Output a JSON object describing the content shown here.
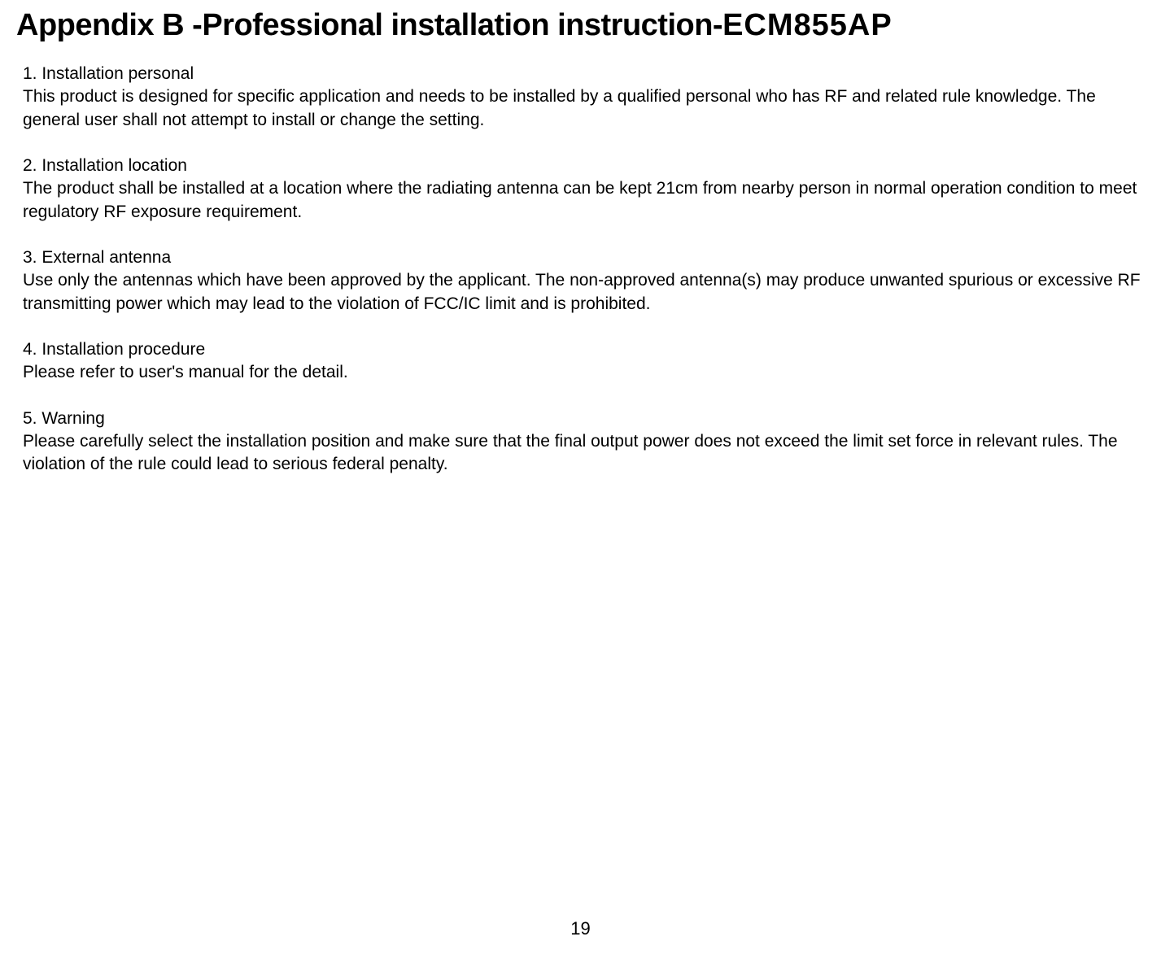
{
  "title": {
    "main": "Appendix B -Professional installation instruction-",
    "model": "ECM855AP"
  },
  "sections": [
    {
      "heading": "1. Installation personal",
      "body": "This product is designed for specific application and needs to be installed by a qualified personal who has RF and related rule knowledge. The general user shall not attempt to install or change the setting."
    },
    {
      "heading": "2. Installation location",
      "body": "The product shall be installed at a location where the radiating antenna can be kept 21cm from nearby person in normal operation condition to meet regulatory RF exposure requirement."
    },
    {
      "heading": "3. External antenna",
      "body": "Use only the antennas which have been approved by the applicant. The non-approved antenna(s) may produce unwanted spurious or excessive RF transmitting power which may lead to the violation of FCC/IC limit and is prohibited."
    },
    {
      "heading": "4. Installation procedure",
      "body": "Please refer to user's manual for the detail."
    },
    {
      "heading": "5. Warning",
      "body": "Please carefully select the installation position and make sure that the final output power does not exceed the limit set force in relevant rules. The violation of the rule could lead to serious federal penalty."
    }
  ],
  "pageNumber": "19"
}
